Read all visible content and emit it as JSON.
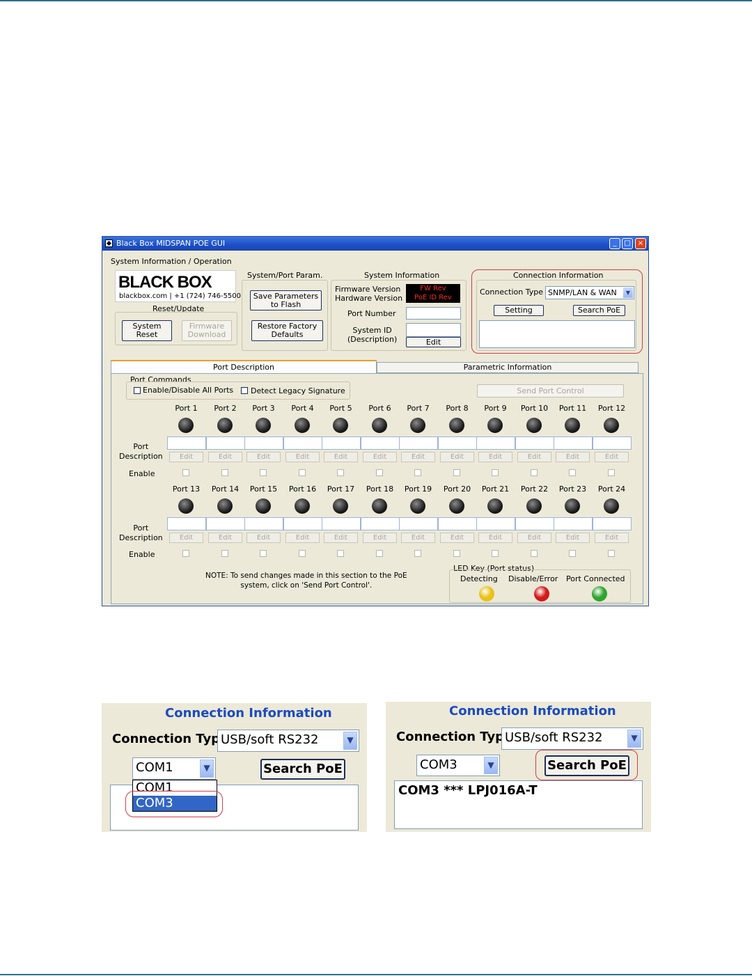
{
  "window": {
    "title": "Black Box MIDSPAN POE GUI",
    "controls": {
      "minimize": "_",
      "maximize": "□",
      "close": "×"
    },
    "sys_op_title": "System Information / Operation",
    "logo": {
      "text": "BLACK BOX",
      "sub": "blackbox.com  |  +1 (724) 746-5500"
    },
    "reset_update_title": "Reset/Update",
    "system_reset": "System\nReset",
    "firmware_download": "Firmware\nDownload",
    "sys_port_param_title": "System/Port Param.",
    "save_parameters": "Save Parameters\nto Flash",
    "restore_defaults": "Restore Factory\nDefaults",
    "sys_info_title": "System Information",
    "firmware_version_label": "Firmware Version",
    "hardware_version_label": "Hardware Version",
    "fw_rev": "FW Rev",
    "poe_id_rev": "PoE ID Rev",
    "port_number_label": "Port Number",
    "system_id_label": "System ID\n(Description)",
    "system_id_edit": "Edit",
    "conn_info_title": "Connection Information",
    "connection_type_label": "Connection Type",
    "connection_type_value": "SNMP/LAN & WAN",
    "setting_button": "Setting",
    "search_poe_button": "Search PoE",
    "tabs": [
      "Port Description",
      "Parametric Information"
    ],
    "port_commands_title": "Port Commands",
    "enable_disable_all": "Enable/Disable All Ports",
    "detect_legacy": "Detect Legacy Signature",
    "send_port_control": "Send Port Control",
    "row_labels": {
      "description": "Port\nDescription",
      "enable": "Enable",
      "edit": "Edit"
    },
    "ports_row1": [
      "Port 1",
      "Port 2",
      "Port 3",
      "Port 4",
      "Port 5",
      "Port 6",
      "Port 7",
      "Port 8",
      "Port 9",
      "Port 10",
      "Port 11",
      "Port 12"
    ],
    "ports_row2": [
      "Port 13",
      "Port 14",
      "Port 15",
      "Port 16",
      "Port 17",
      "Port 18",
      "Port 19",
      "Port 20",
      "Port 21",
      "Port 22",
      "Port 23",
      "Port 24"
    ],
    "note": "NOTE: To send changes made in this section to the PoE\nsystem, click on 'Send Port Control'.",
    "led_key_title": "LED Key (Port status)",
    "led_key": [
      {
        "label": "Detecting",
        "color": "#e8c21a"
      },
      {
        "label": "Disable/Error",
        "color": "#d11a1a"
      },
      {
        "label": "Port Connected",
        "color": "#2fa52f"
      }
    ]
  },
  "zoom_left": {
    "title": "Connection Information",
    "connection_type_label": "Connection Type",
    "connection_type_value": "USB/soft RS232",
    "com_value": "COM1",
    "search_poe": "Search PoE",
    "dropdown_options": [
      "COM1",
      "COM3"
    ],
    "selected_option": "COM3"
  },
  "zoom_right": {
    "title": "Connection Information",
    "connection_type_label": "Connection Type",
    "connection_type_value": "USB/soft RS232",
    "com_value": "COM3",
    "search_poe": "Search PoE",
    "result_text": "COM3 *** LPJ016A-T"
  }
}
